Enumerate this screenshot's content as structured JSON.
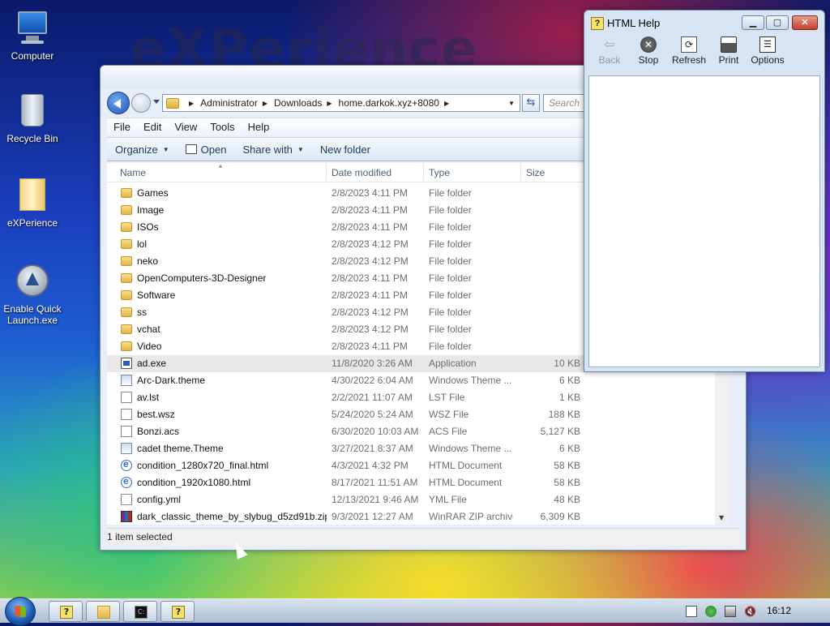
{
  "wallpaper": {
    "watermark": "eXPerience"
  },
  "desktop": {
    "icons": [
      {
        "label": "Computer"
      },
      {
        "label": "Recycle Bin"
      },
      {
        "label": "eXPerience"
      },
      {
        "label": "Enable Quick Launch.exe"
      }
    ]
  },
  "explorer": {
    "breadcrumbs": [
      "Administrator",
      "Downloads",
      "home.darkok.xyz+8080"
    ],
    "search_placeholder": "Search",
    "menu": [
      "File",
      "Edit",
      "View",
      "Tools",
      "Help"
    ],
    "commands": {
      "organize": "Organize",
      "open": "Open",
      "share_with": "Share with",
      "new_folder": "New folder"
    },
    "columns": {
      "name": "Name",
      "date": "Date modified",
      "type": "Type",
      "size": "Size"
    },
    "rows": [
      {
        "name": "Games",
        "date": "2/8/2023 4:11 PM",
        "type": "File folder",
        "size": "",
        "icon": "folder-icon"
      },
      {
        "name": "Image",
        "date": "2/8/2023 4:11 PM",
        "type": "File folder",
        "size": "",
        "icon": "folder-icon"
      },
      {
        "name": "ISOs",
        "date": "2/8/2023 4:11 PM",
        "type": "File folder",
        "size": "",
        "icon": "folder-icon"
      },
      {
        "name": "lol",
        "date": "2/8/2023 4:12 PM",
        "type": "File folder",
        "size": "",
        "icon": "folder-icon"
      },
      {
        "name": "neko",
        "date": "2/8/2023 4:12 PM",
        "type": "File folder",
        "size": "",
        "icon": "folder-icon"
      },
      {
        "name": "OpenComputers-3D-Designer",
        "date": "2/8/2023 4:11 PM",
        "type": "File folder",
        "size": "",
        "icon": "folder-icon"
      },
      {
        "name": "Software",
        "date": "2/8/2023 4:11 PM",
        "type": "File folder",
        "size": "",
        "icon": "folder-icon"
      },
      {
        "name": "ss",
        "date": "2/8/2023 4:12 PM",
        "type": "File folder",
        "size": "",
        "icon": "folder-icon"
      },
      {
        "name": "vchat",
        "date": "2/8/2023 4:12 PM",
        "type": "File folder",
        "size": "",
        "icon": "folder-icon"
      },
      {
        "name": "Video",
        "date": "2/8/2023 4:11 PM",
        "type": "File folder",
        "size": "",
        "icon": "folder-icon"
      },
      {
        "name": "ad.exe",
        "date": "11/8/2020 3:26 AM",
        "type": "Application",
        "size": "10 KB",
        "icon": "exe-icon",
        "selected": true
      },
      {
        "name": "Arc-Dark.theme",
        "date": "4/30/2022 6:04 AM",
        "type": "Windows Theme ...",
        "size": "6 KB",
        "icon": "theme-icon"
      },
      {
        "name": "av.lst",
        "date": "2/2/2021 11:07 AM",
        "type": "LST File",
        "size": "1 KB",
        "icon": "file-icon"
      },
      {
        "name": "best.wsz",
        "date": "5/24/2020 5:24 AM",
        "type": "WSZ File",
        "size": "188 KB",
        "icon": "file-icon"
      },
      {
        "name": "Bonzi.acs",
        "date": "6/30/2020 10:03 AM",
        "type": "ACS File",
        "size": "5,127 KB",
        "icon": "file-icon"
      },
      {
        "name": "cadet theme.Theme",
        "date": "3/27/2021 8:37 AM",
        "type": "Windows Theme ...",
        "size": "6 KB",
        "icon": "theme-icon"
      },
      {
        "name": "condition_1280x720_final.html",
        "date": "4/3/2021 4:32 PM",
        "type": "HTML Document",
        "size": "58 KB",
        "icon": "html-icon"
      },
      {
        "name": "condition_1920x1080.html",
        "date": "8/17/2021 11:51 AM",
        "type": "HTML Document",
        "size": "58 KB",
        "icon": "html-icon"
      },
      {
        "name": "config.yml",
        "date": "12/13/2021 9:46 AM",
        "type": "YML File",
        "size": "48 KB",
        "icon": "file-icon"
      },
      {
        "name": "dark_classic_theme_by_slybug_d5zd91b.zip",
        "date": "9/3/2021 12:27 AM",
        "type": "WinRAR ZIP archive",
        "size": "6,309 KB",
        "icon": "zip-icon"
      }
    ],
    "status": "1 item selected"
  },
  "help": {
    "title": "HTML Help",
    "buttons": {
      "back": "Back",
      "stop": "Stop",
      "refresh": "Refresh",
      "print": "Print",
      "options": "Options"
    }
  },
  "taskbar": {
    "clock": "16:12"
  }
}
